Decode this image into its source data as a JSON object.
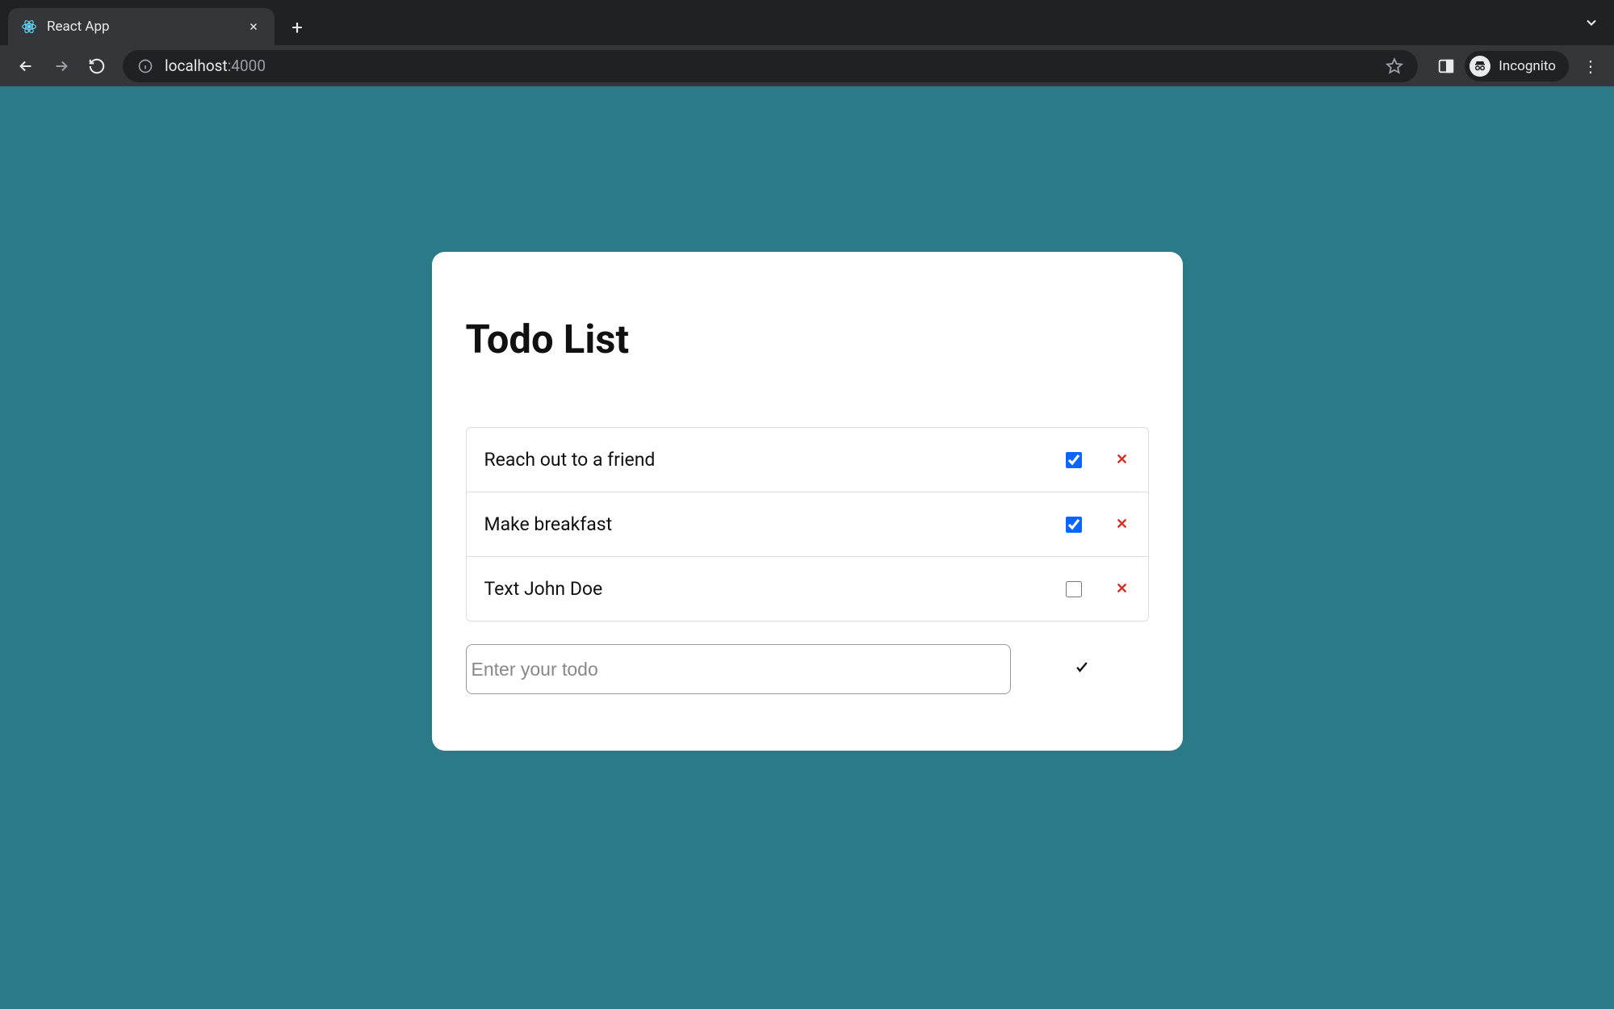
{
  "browser": {
    "tab_title": "React App",
    "url_host": "localhost",
    "url_port": ":4000",
    "incognito_label": "Incognito"
  },
  "app": {
    "title": "Todo List",
    "input_placeholder": "Enter your todo",
    "todos": [
      {
        "text": "Reach out to a friend",
        "done": true
      },
      {
        "text": "Make breakfast",
        "done": true
      },
      {
        "text": "Text John Doe",
        "done": false
      }
    ]
  }
}
